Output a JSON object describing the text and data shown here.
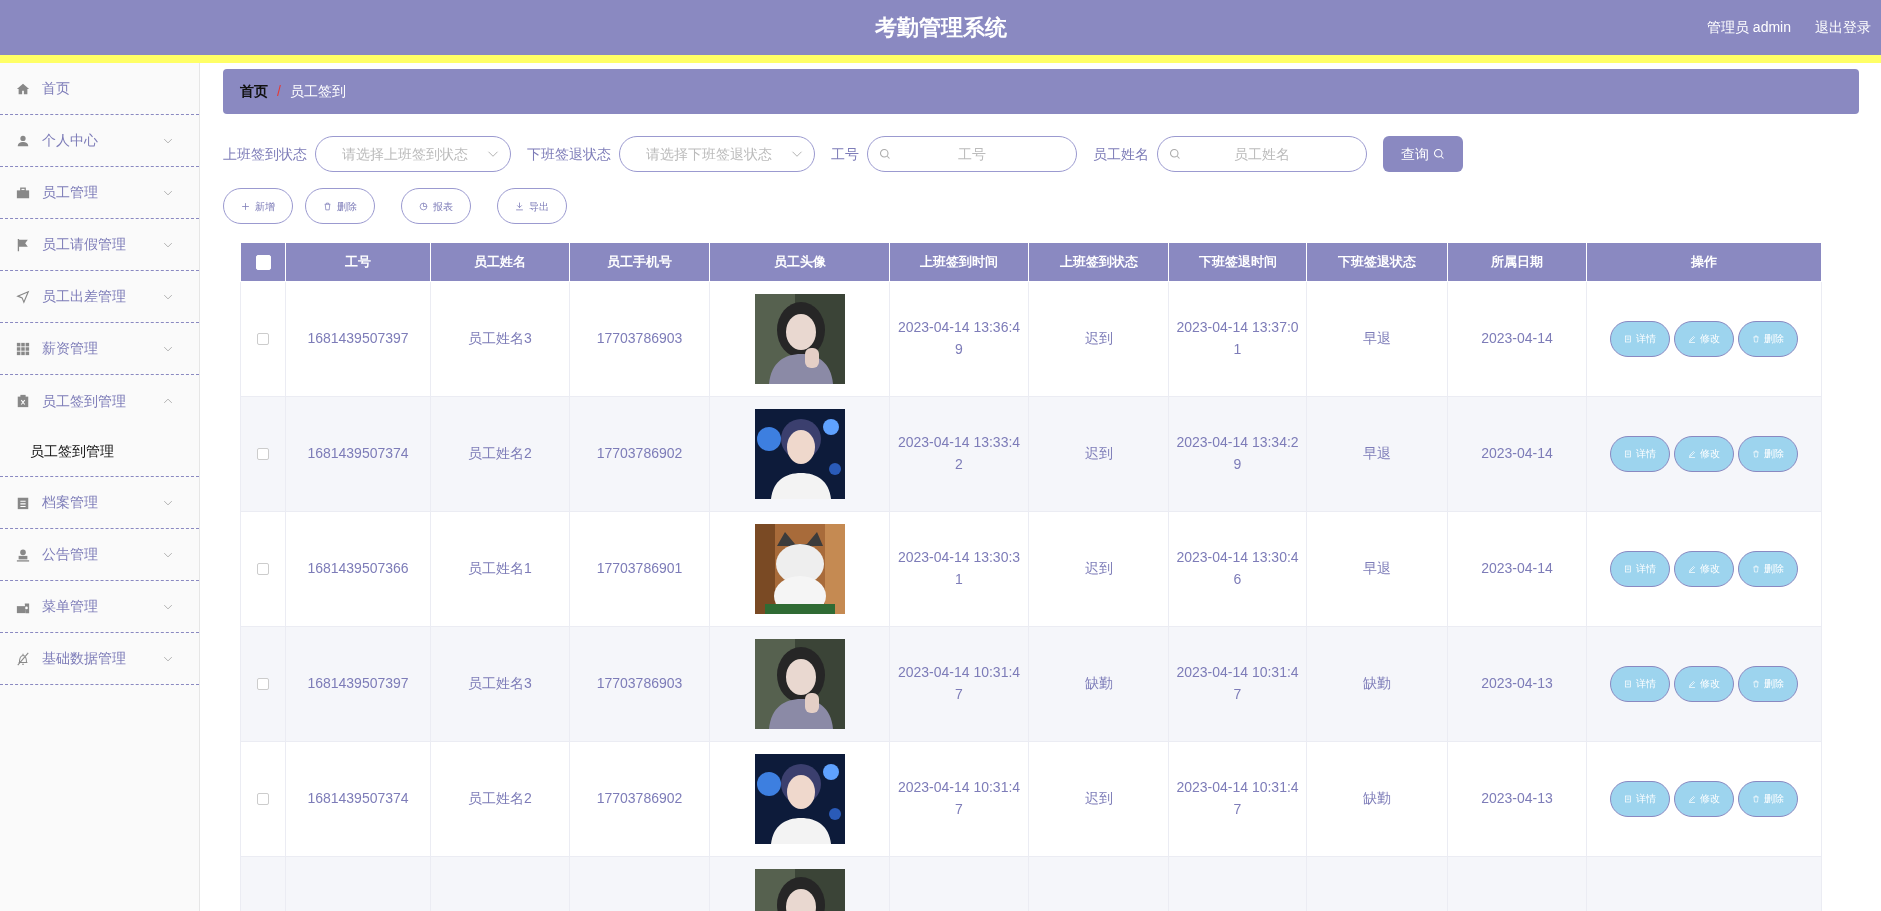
{
  "header": {
    "title": "考勤管理系统",
    "user": "管理员 admin",
    "logout": "退出登录"
  },
  "sidebar": {
    "items": [
      {
        "label": "首页"
      },
      {
        "label": "个人中心",
        "expanded": false
      },
      {
        "label": "员工管理",
        "expanded": false
      },
      {
        "label": "员工请假管理",
        "expanded": false
      },
      {
        "label": "员工出差管理",
        "expanded": false
      },
      {
        "label": "薪资管理",
        "expanded": false
      },
      {
        "label": "员工签到管理",
        "expanded": true,
        "children": [
          {
            "label": "员工签到管理"
          }
        ]
      },
      {
        "label": "档案管理",
        "expanded": false
      },
      {
        "label": "公告管理",
        "expanded": false
      },
      {
        "label": "菜单管理",
        "expanded": false
      },
      {
        "label": "基础数据管理",
        "expanded": false
      }
    ]
  },
  "breadcrumb": {
    "items": [
      "首页",
      "员工签到"
    ],
    "separator": "/"
  },
  "filters": [
    {
      "kind": "select",
      "label": "上班签到状态",
      "placeholder": "请选择上班签到状态"
    },
    {
      "kind": "select",
      "label": "下班签退状态",
      "placeholder": "请选择下班签退状态"
    },
    {
      "kind": "search",
      "label": "工号",
      "placeholder": "工号"
    },
    {
      "kind": "search",
      "label": "员工姓名",
      "placeholder": "员工姓名"
    }
  ],
  "query_button": "查询",
  "actions": [
    "新增",
    "删除",
    "报表",
    "导出"
  ],
  "table": {
    "select_all": false,
    "columns": [
      "工号",
      "员工姓名",
      "员工手机号",
      "员工头像",
      "上班签到时间",
      "上班签到状态",
      "下班签退时间",
      "下班签退状态",
      "所属日期",
      "操作"
    ],
    "rows": [
      {
        "checked": false,
        "id": "1681439507397",
        "name": "员工姓名3",
        "phone": "17703786903",
        "avatar": {
          "kind": "picture"
        },
        "checkin_time": "2023-04-14 13:36:49",
        "checkin_status": "迟到",
        "checkout_time": "2023-04-14 13:37:01",
        "checkout_status": "早退",
        "date": "2023-04-14",
        "buttons": [
          "详情",
          "修改",
          "删除"
        ]
      },
      {
        "checked": false,
        "id": "1681439507374",
        "name": "员工姓名2",
        "phone": "17703786902",
        "avatar": {
          "kind": "picture"
        },
        "checkin_time": "2023-04-14 13:33:42",
        "checkin_status": "迟到",
        "checkout_time": "2023-04-14 13:34:29",
        "checkout_status": "早退",
        "date": "2023-04-14",
        "buttons": [
          "详情",
          "修改",
          "删除"
        ]
      },
      {
        "checked": false,
        "id": "1681439507366",
        "name": "员工姓名1",
        "phone": "17703786901",
        "avatar": {
          "kind": "picture"
        },
        "checkin_time": "2023-04-14 13:30:31",
        "checkin_status": "迟到",
        "checkout_time": "2023-04-14 13:30:46",
        "checkout_status": "早退",
        "date": "2023-04-14",
        "buttons": [
          "详情",
          "修改",
          "删除"
        ]
      },
      {
        "checked": false,
        "id": "1681439507397",
        "name": "员工姓名3",
        "phone": "17703786903",
        "avatar": {
          "kind": "picture"
        },
        "checkin_time": "2023-04-14 10:31:47",
        "checkin_status": "缺勤",
        "checkout_time": "2023-04-14 10:31:47",
        "checkout_status": "缺勤",
        "date": "2023-04-13",
        "buttons": [
          "详情",
          "修改",
          "删除"
        ]
      },
      {
        "checked": false,
        "id": "1681439507374",
        "name": "员工姓名2",
        "phone": "17703786902",
        "avatar": {
          "kind": "picture"
        },
        "checkin_time": "2023-04-14 10:31:47",
        "checkin_status": "迟到",
        "checkout_time": "2023-04-14 10:31:47",
        "checkout_status": "缺勤",
        "date": "2023-04-13",
        "buttons": [
          "详情",
          "修改",
          "删除"
        ]
      },
      {
        "avatar": {
          "kind": "picture"
        }
      }
    ]
  }
}
